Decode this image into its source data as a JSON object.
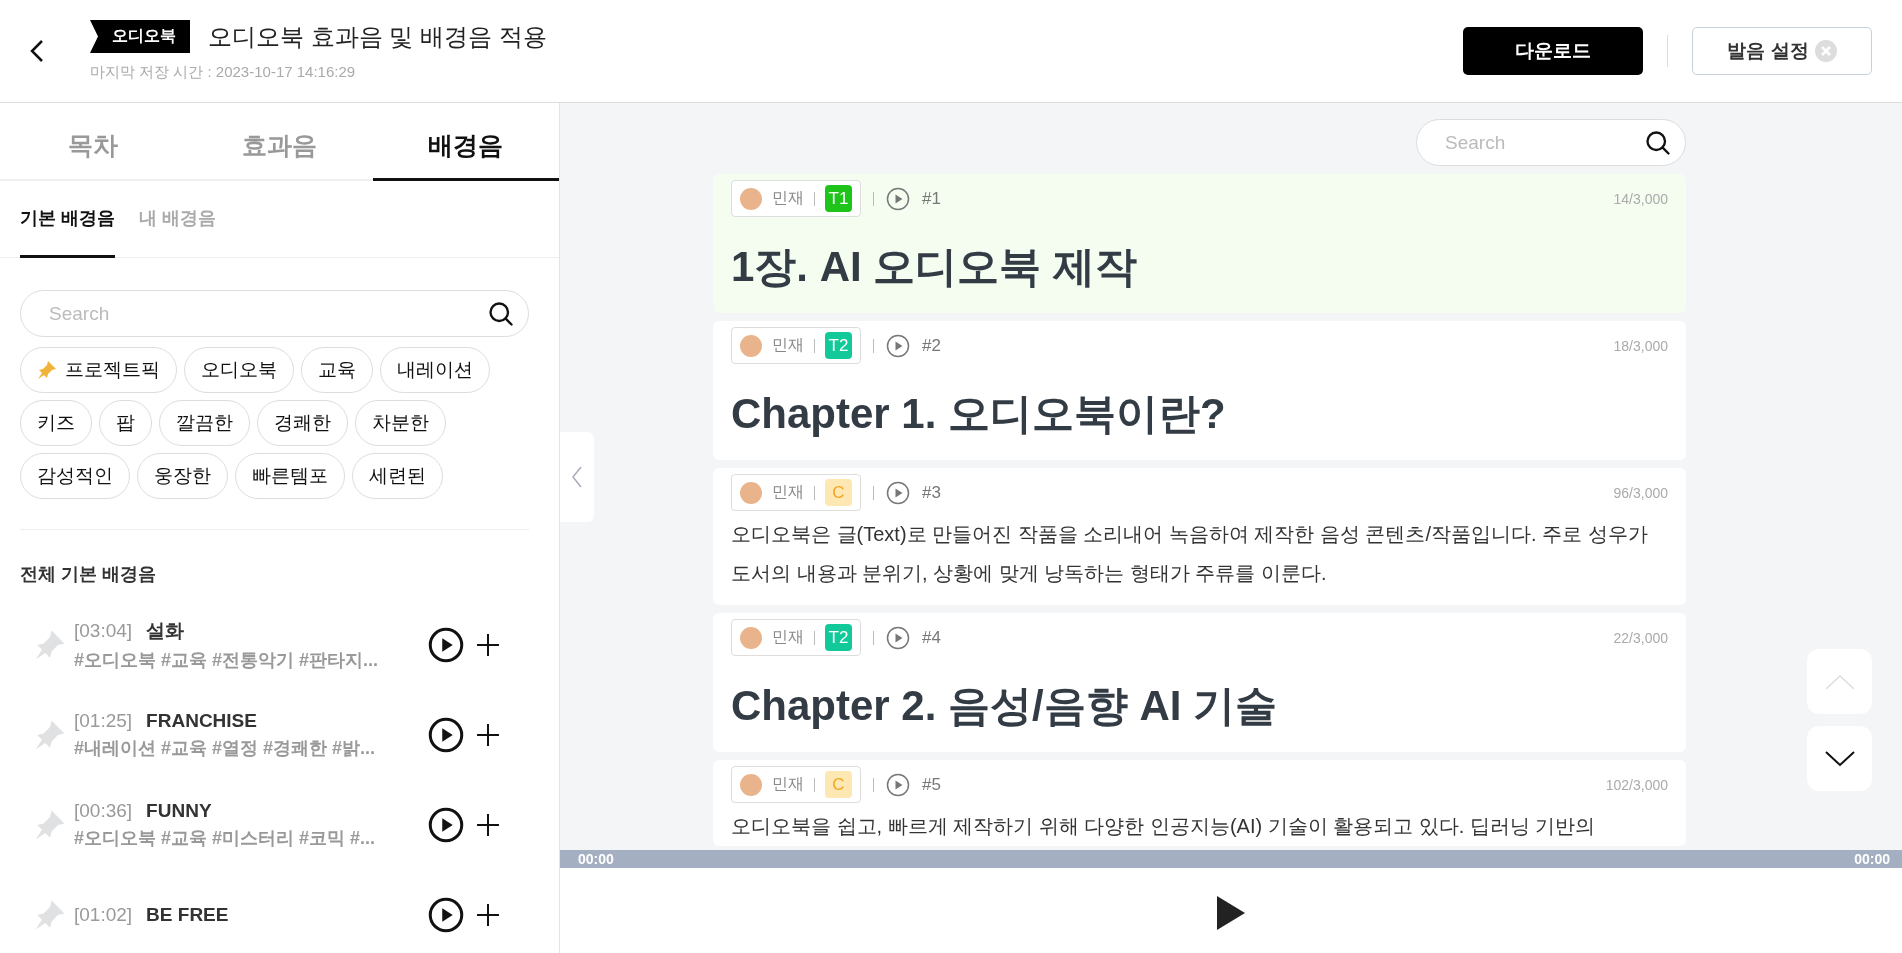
{
  "header": {
    "badge": "오디오북",
    "title": "오디오북 효과음 및 배경음 적용",
    "saved_time": "마지막 저장 시간 : 2023-10-17 14:16:29",
    "download_button": "다운로드",
    "pronunciation_button": "발음 설정"
  },
  "tabs": [
    {
      "label": "목차",
      "selected": false
    },
    {
      "label": "효과음",
      "selected": false
    },
    {
      "label": "배경음",
      "selected": true
    }
  ],
  "subtabs": [
    {
      "label": "기본 배경음",
      "selected": true
    },
    {
      "label": "내 배경음",
      "selected": false
    }
  ],
  "sidebar_search": {
    "placeholder": "Search"
  },
  "chips": [
    {
      "label": "프로젝트픽",
      "kind": "pinned"
    },
    {
      "label": "오디오북",
      "kind": "plain"
    },
    {
      "label": "교육",
      "kind": "plain"
    },
    {
      "label": "내레이션",
      "kind": "plain"
    },
    {
      "label": "키즈",
      "kind": "plain"
    },
    {
      "label": "팝",
      "kind": "plain"
    },
    {
      "label": "깔끔한",
      "kind": "plain"
    },
    {
      "label": "경쾌한",
      "kind": "plain"
    },
    {
      "label": "차분한",
      "kind": "plain"
    },
    {
      "label": "감성적인",
      "kind": "plain"
    },
    {
      "label": "웅장한",
      "kind": "plain"
    },
    {
      "label": "빠른템포",
      "kind": "plain"
    },
    {
      "label": "세련된",
      "kind": "plain"
    }
  ],
  "section_title": "전체 기본 배경음",
  "tracks": [
    {
      "time": "[03:04]",
      "title": "설화",
      "tags": "#오디오북 #교육 #전통악기 #판타지...",
      "pinned": false
    },
    {
      "time": "[01:25]",
      "title": "FRANCHISE",
      "tags": "#내레이션 #교육 #열정 #경쾌한 #밝...",
      "pinned": false
    },
    {
      "time": "[00:36]",
      "title": "FUNNY",
      "tags": "#오디오북 #교육 #미스터리 #코믹 #...",
      "pinned": false
    },
    {
      "time": "[01:02]",
      "title": "BE FREE",
      "pinned": false
    }
  ],
  "main_search": {
    "placeholder": "Search"
  },
  "blocks": [
    {
      "speaker": "민재",
      "tag": {
        "label": "T1",
        "kind": "solid",
        "color": "#1ec41a"
      },
      "number": "#1",
      "count": "14/3,000",
      "kind": "heading",
      "text": "1장. AI 오디오북 제작",
      "selected": true
    },
    {
      "speaker": "민재",
      "tag": {
        "label": "T2",
        "kind": "solid",
        "color": "#12c99a"
      },
      "number": "#2",
      "count": "18/3,000",
      "kind": "heading",
      "text": "Chapter 1. 오디오북이란?",
      "selected": false
    },
    {
      "speaker": "민재",
      "tag": {
        "label": "C",
        "kind": "soft",
        "color": "#fde8b4"
      },
      "number": "#3",
      "count": "96/3,000",
      "kind": "paragraph",
      "text": "오디오북은 글(Text)로 만들어진 작품을 소리내어 녹음하여 제작한 음성 콘텐츠/작품입니다. 주로 성우가 도서의 내용과 분위기, 상황에 맞게 낭독하는 형태가 주류를 이룬다.",
      "selected": false
    },
    {
      "speaker": "민재",
      "tag": {
        "label": "T2",
        "kind": "solid",
        "color": "#12c99a"
      },
      "number": "#4",
      "count": "22/3,000",
      "kind": "heading",
      "text": "Chapter 2. 음성/음향 AI 기술",
      "selected": false
    },
    {
      "speaker": "민재",
      "tag": {
        "label": "C",
        "kind": "soft",
        "color": "#fde8b4"
      },
      "number": "#5",
      "count": "102/3,000",
      "kind": "paragraph",
      "text": "오디오북을 쉽고, 빠르게 제작하기 위해 다양한 인공지능(AI) 기술이 활용되고 있다. 딥러닝 기반의",
      "selected": false
    }
  ],
  "player": {
    "current_time": "00:00",
    "total_time": "00:00"
  }
}
